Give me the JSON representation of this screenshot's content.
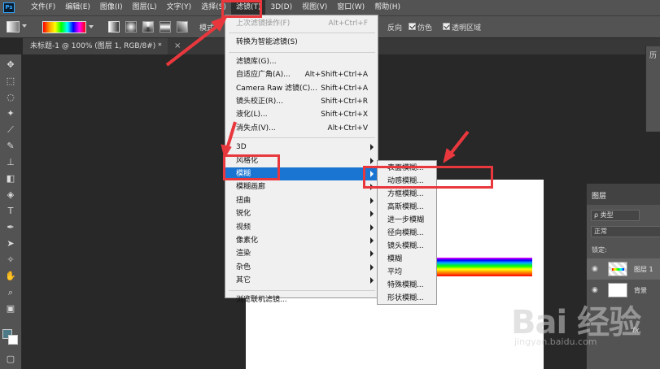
{
  "app": {
    "logo": "Ps"
  },
  "menubar": {
    "items": [
      "文件(F)",
      "编辑(E)",
      "图像(I)",
      "图层(L)",
      "文字(Y)",
      "选择(S)",
      "滤镜(T)",
      "3D(D)",
      "视图(V)",
      "窗口(W)",
      "帮助(H)"
    ],
    "active": "滤镜(T)"
  },
  "options": {
    "mode_label": "模式",
    "reverse_label": "反向",
    "dither_label": "仿色",
    "dither_checked": true,
    "transparency_label": "透明区域",
    "transparency_checked": true
  },
  "document": {
    "tab_title": "未标题-1 @ 100% (图层 1, RGB/8#) *",
    "tab_close": "×"
  },
  "filter_menu": {
    "items": [
      {
        "label": "上次滤镜操作(F)",
        "shortcut": "Alt+Ctrl+F",
        "disabled": true
      },
      {
        "separator": true
      },
      {
        "label": "转换为智能滤镜(S)"
      },
      {
        "separator": true
      },
      {
        "label": "滤镜库(G)..."
      },
      {
        "label": "自适应广角(A)...",
        "shortcut": "Alt+Shift+Ctrl+A"
      },
      {
        "label": "Camera Raw 滤镜(C)...",
        "shortcut": "Shift+Ctrl+A"
      },
      {
        "label": "镜头校正(R)...",
        "shortcut": "Shift+Ctrl+R"
      },
      {
        "label": "液化(L)...",
        "shortcut": "Shift+Ctrl+X"
      },
      {
        "label": "消失点(V)...",
        "shortcut": "Alt+Ctrl+V"
      },
      {
        "separator": true
      },
      {
        "label": "3D",
        "submenu": true
      },
      {
        "label": "风格化",
        "submenu": true
      },
      {
        "label": "模糊",
        "submenu": true,
        "highlighted": true
      },
      {
        "label": "模糊画廊",
        "submenu": true
      },
      {
        "label": "扭曲",
        "submenu": true
      },
      {
        "label": "锐化",
        "submenu": true
      },
      {
        "label": "视频",
        "submenu": true
      },
      {
        "label": "像素化",
        "submenu": true
      },
      {
        "label": "渲染",
        "submenu": true
      },
      {
        "label": "杂色",
        "submenu": true
      },
      {
        "label": "其它",
        "submenu": true
      },
      {
        "separator": true
      },
      {
        "label": "浏览联机滤镜..."
      }
    ]
  },
  "blur_submenu": {
    "items": [
      "表面模糊...",
      "动感模糊...",
      "方框模糊...",
      "高斯模糊...",
      "进一步模糊",
      "径向模糊...",
      "镜头模糊...",
      "模糊",
      "平均",
      "特殊模糊...",
      "形状模糊..."
    ]
  },
  "history_panel": {
    "title": "历"
  },
  "layers_panel": {
    "tab": "图层",
    "filter_kind": "ρ 类型",
    "blend_mode": "正常",
    "lock_label": "锁定:",
    "layers": [
      {
        "name": "图层 1",
        "selected": true
      },
      {
        "name": "背景",
        "selected": false
      }
    ],
    "footer_fx": "fx."
  },
  "watermark": {
    "text": "Bai 经验",
    "url": "jingyan.baidu.com"
  },
  "colors": {
    "annotation_red": "#e8383d",
    "menu_highlight": "#1a74d2",
    "foreground": "#4d7a87",
    "background": "#ffffff"
  }
}
